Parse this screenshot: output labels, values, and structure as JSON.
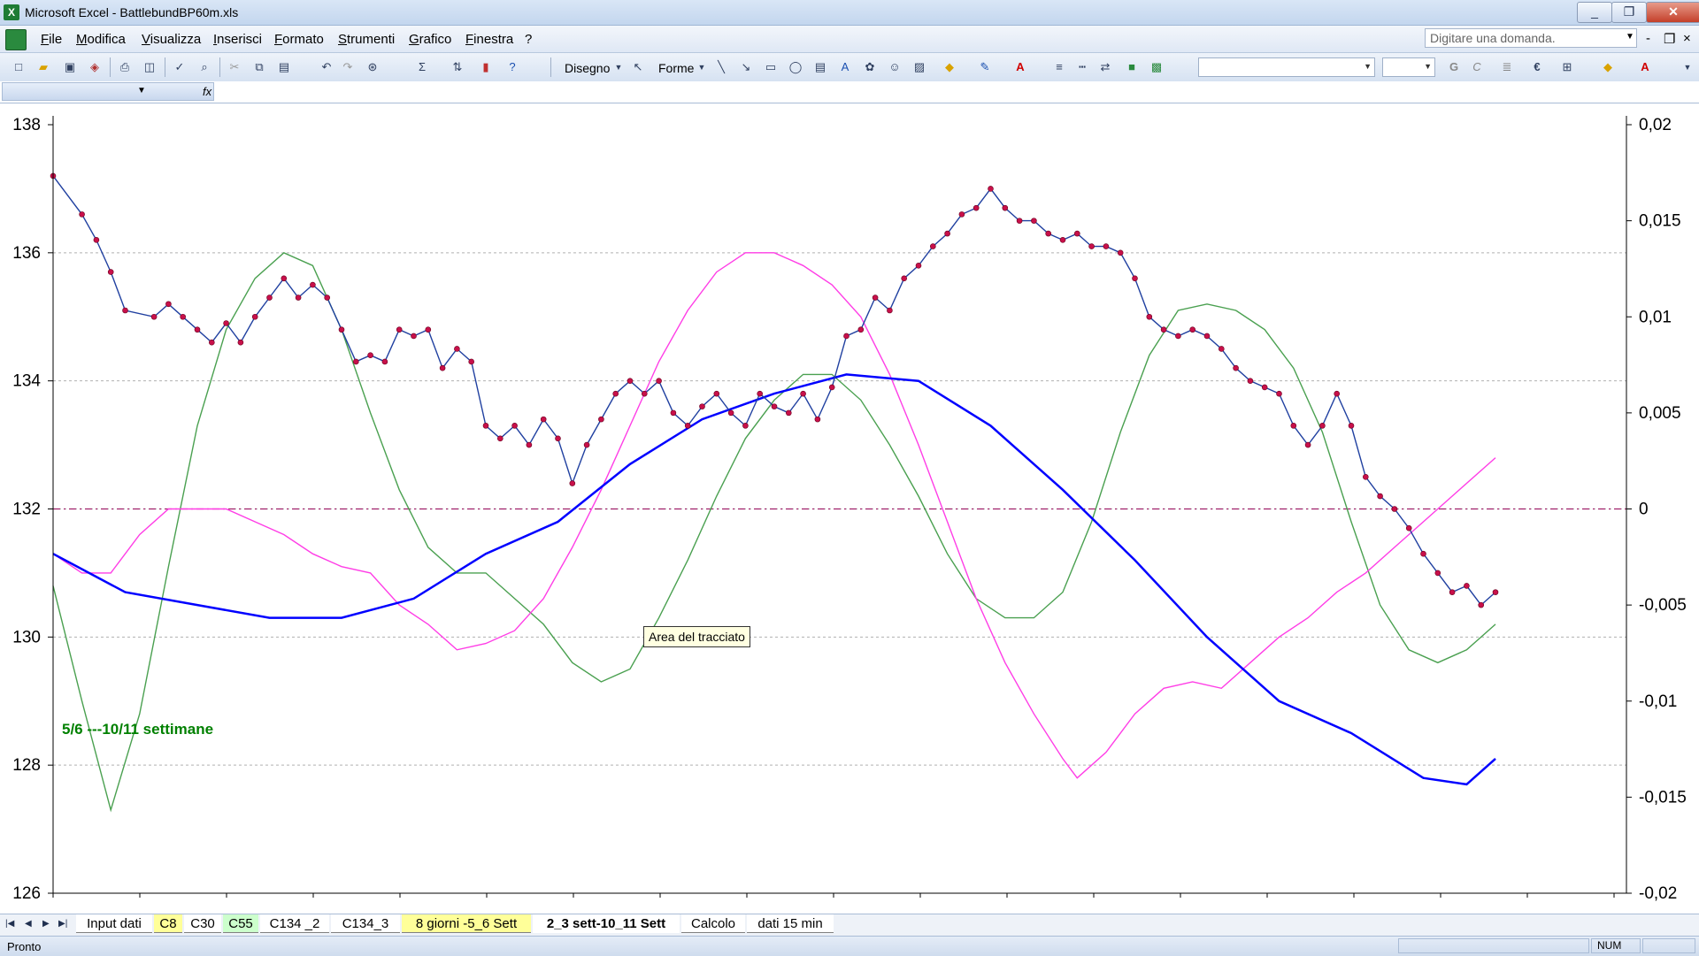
{
  "window": {
    "title": "Microsoft Excel - BattlebundBP60m.xls",
    "minimize": "_",
    "maximize": "❐",
    "close": "✕"
  },
  "menubar": {
    "items": [
      "File",
      "Modifica",
      "Visualizza",
      "Inserisci",
      "Formato",
      "Strumenti",
      "Grafico",
      "Finestra",
      "?"
    ],
    "help_placeholder": "Digitare una domanda.",
    "mdi_controls": [
      "-",
      "❐",
      "×"
    ]
  },
  "toolbar": {
    "draw_label": "Disegno",
    "shapes_label": "Forme"
  },
  "sheet_tabs": [
    {
      "label": "Input dati",
      "style": "normal"
    },
    {
      "label": "C8",
      "style": "yellow"
    },
    {
      "label": "C30",
      "style": "normal"
    },
    {
      "label": "C55",
      "style": "green"
    },
    {
      "label": "C134 _2",
      "style": "normal"
    },
    {
      "label": "C134_3",
      "style": "normal"
    },
    {
      "label": "8 giorni -5_6 Sett",
      "style": "yellow"
    },
    {
      "label": "2_3 sett-10_11 Sett",
      "style": "active"
    },
    {
      "label": "Calcolo",
      "style": "normal"
    },
    {
      "label": "dati 15 min",
      "style": "normal"
    }
  ],
  "status": {
    "text": "Pronto",
    "num": "NUM"
  },
  "tooltip": "Area del tracciato",
  "chart_data": {
    "type": "line",
    "annotation": "5/6 ---10/11 settimane",
    "y_left": {
      "min": 126,
      "max": 138,
      "ticks": [
        "138",
        "136",
        "134",
        "132",
        "130",
        "128",
        "126"
      ]
    },
    "y_right": {
      "min": -0.02,
      "max": 0.02,
      "ticks": [
        "0,02",
        "0,015",
        "0,01",
        "0,005",
        "0",
        "-0,005",
        "-0,01",
        "-0,015",
        "-0,02"
      ]
    },
    "gridlines": true,
    "x_range": [
      0,
      100
    ],
    "series": [
      {
        "color": "#2040a0",
        "marker_color": "#c8104a",
        "axis": "left",
        "points": [
          [
            0,
            137.2
          ],
          [
            2,
            136.6
          ],
          [
            3,
            136.2
          ],
          [
            4,
            135.7
          ],
          [
            5,
            135.1
          ],
          [
            7,
            135.0
          ],
          [
            8,
            135.2
          ],
          [
            9,
            135.0
          ],
          [
            10,
            134.8
          ],
          [
            11,
            134.6
          ],
          [
            12,
            134.9
          ],
          [
            13,
            134.6
          ],
          [
            14,
            135.0
          ],
          [
            15,
            135.3
          ],
          [
            16,
            135.6
          ],
          [
            17,
            135.3
          ],
          [
            18,
            135.5
          ],
          [
            19,
            135.3
          ],
          [
            20,
            134.8
          ],
          [
            21,
            134.3
          ],
          [
            22,
            134.4
          ],
          [
            23,
            134.3
          ],
          [
            24,
            134.8
          ],
          [
            25,
            134.7
          ],
          [
            26,
            134.8
          ],
          [
            27,
            134.2
          ],
          [
            28,
            134.5
          ],
          [
            29,
            134.3
          ],
          [
            30,
            133.3
          ],
          [
            31,
            133.1
          ],
          [
            32,
            133.3
          ],
          [
            33,
            133.0
          ],
          [
            34,
            133.4
          ],
          [
            35,
            133.1
          ],
          [
            36,
            132.4
          ],
          [
            37,
            133.0
          ],
          [
            38,
            133.4
          ],
          [
            39,
            133.8
          ],
          [
            40,
            134.0
          ],
          [
            41,
            133.8
          ],
          [
            42,
            134.0
          ],
          [
            43,
            133.5
          ],
          [
            44,
            133.3
          ],
          [
            45,
            133.6
          ],
          [
            46,
            133.8
          ],
          [
            47,
            133.5
          ],
          [
            48,
            133.3
          ],
          [
            49,
            133.8
          ],
          [
            50,
            133.6
          ],
          [
            51,
            133.5
          ],
          [
            52,
            133.8
          ],
          [
            53,
            133.4
          ],
          [
            54,
            133.9
          ],
          [
            55,
            134.7
          ],
          [
            56,
            134.8
          ],
          [
            57,
            135.3
          ],
          [
            58,
            135.1
          ],
          [
            59,
            135.6
          ],
          [
            60,
            135.8
          ],
          [
            61,
            136.1
          ],
          [
            62,
            136.3
          ],
          [
            63,
            136.6
          ],
          [
            64,
            136.7
          ],
          [
            65,
            137.0
          ],
          [
            66,
            136.7
          ],
          [
            67,
            136.5
          ],
          [
            68,
            136.5
          ],
          [
            69,
            136.3
          ],
          [
            70,
            136.2
          ],
          [
            71,
            136.3
          ],
          [
            72,
            136.1
          ],
          [
            73,
            136.1
          ],
          [
            74,
            136.0
          ],
          [
            75,
            135.6
          ],
          [
            76,
            135.0
          ],
          [
            77,
            134.8
          ],
          [
            78,
            134.7
          ],
          [
            79,
            134.8
          ],
          [
            80,
            134.7
          ],
          [
            81,
            134.5
          ],
          [
            82,
            134.2
          ],
          [
            83,
            134.0
          ],
          [
            84,
            133.9
          ],
          [
            85,
            133.8
          ],
          [
            86,
            133.3
          ],
          [
            87,
            133.0
          ],
          [
            88,
            133.3
          ],
          [
            89,
            133.8
          ],
          [
            90,
            133.3
          ],
          [
            91,
            132.5
          ],
          [
            92,
            132.2
          ],
          [
            93,
            132.0
          ],
          [
            94,
            131.7
          ],
          [
            95,
            131.3
          ],
          [
            96,
            131.0
          ],
          [
            97,
            130.7
          ],
          [
            98,
            130.8
          ],
          [
            99,
            130.5
          ],
          [
            100,
            130.7
          ]
        ]
      },
      {
        "color": "#0000ff",
        "width": 2.5,
        "axis": "left",
        "points": [
          [
            0,
            131.3
          ],
          [
            5,
            130.7
          ],
          [
            10,
            130.5
          ],
          [
            15,
            130.3
          ],
          [
            20,
            130.3
          ],
          [
            25,
            130.6
          ],
          [
            30,
            131.3
          ],
          [
            35,
            131.8
          ],
          [
            40,
            132.7
          ],
          [
            45,
            133.4
          ],
          [
            50,
            133.8
          ],
          [
            55,
            134.1
          ],
          [
            60,
            134.0
          ],
          [
            65,
            133.3
          ],
          [
            70,
            132.3
          ],
          [
            75,
            131.2
          ],
          [
            80,
            130.0
          ],
          [
            85,
            129.0
          ],
          [
            90,
            128.5
          ],
          [
            95,
            127.8
          ],
          [
            98,
            127.7
          ],
          [
            100,
            128.1
          ]
        ]
      },
      {
        "color": "#ff3de6",
        "axis": "left",
        "points": [
          [
            0,
            131.3
          ],
          [
            2,
            131.0
          ],
          [
            4,
            131.0
          ],
          [
            6,
            131.6
          ],
          [
            8,
            132.0
          ],
          [
            10,
            132.0
          ],
          [
            12,
            132.0
          ],
          [
            14,
            131.8
          ],
          [
            16,
            131.6
          ],
          [
            18,
            131.3
          ],
          [
            20,
            131.1
          ],
          [
            22,
            131.0
          ],
          [
            24,
            130.5
          ],
          [
            26,
            130.2
          ],
          [
            28,
            129.8
          ],
          [
            30,
            129.9
          ],
          [
            32,
            130.1
          ],
          [
            34,
            130.6
          ],
          [
            36,
            131.4
          ],
          [
            38,
            132.3
          ],
          [
            40,
            133.3
          ],
          [
            42,
            134.3
          ],
          [
            44,
            135.1
          ],
          [
            46,
            135.7
          ],
          [
            48,
            136.0
          ],
          [
            50,
            136.0
          ],
          [
            52,
            135.8
          ],
          [
            54,
            135.5
          ],
          [
            56,
            135.0
          ],
          [
            58,
            134.1
          ],
          [
            60,
            133.0
          ],
          [
            62,
            131.8
          ],
          [
            64,
            130.6
          ],
          [
            66,
            129.6
          ],
          [
            68,
            128.8
          ],
          [
            70,
            128.1
          ],
          [
            71,
            127.8
          ],
          [
            73,
            128.2
          ],
          [
            75,
            128.8
          ],
          [
            77,
            129.2
          ],
          [
            79,
            129.3
          ],
          [
            81,
            129.2
          ],
          [
            83,
            129.6
          ],
          [
            85,
            130.0
          ],
          [
            87,
            130.3
          ],
          [
            89,
            130.7
          ],
          [
            91,
            131.0
          ],
          [
            93,
            131.4
          ],
          [
            95,
            131.8
          ],
          [
            97,
            132.2
          ],
          [
            100,
            132.8
          ]
        ]
      },
      {
        "color": "#4aa050",
        "axis": "left",
        "points": [
          [
            0,
            130.8
          ],
          [
            2,
            129.0
          ],
          [
            4,
            127.3
          ],
          [
            6,
            128.8
          ],
          [
            8,
            131.1
          ],
          [
            10,
            133.3
          ],
          [
            12,
            134.8
          ],
          [
            14,
            135.6
          ],
          [
            16,
            136.0
          ],
          [
            18,
            135.8
          ],
          [
            20,
            134.8
          ],
          [
            22,
            133.5
          ],
          [
            24,
            132.3
          ],
          [
            26,
            131.4
          ],
          [
            28,
            131.0
          ],
          [
            30,
            131.0
          ],
          [
            32,
            130.6
          ],
          [
            34,
            130.2
          ],
          [
            36,
            129.6
          ],
          [
            38,
            129.3
          ],
          [
            40,
            129.5
          ],
          [
            42,
            130.3
          ],
          [
            44,
            131.2
          ],
          [
            46,
            132.2
          ],
          [
            48,
            133.1
          ],
          [
            50,
            133.7
          ],
          [
            52,
            134.1
          ],
          [
            54,
            134.1
          ],
          [
            56,
            133.7
          ],
          [
            58,
            133.0
          ],
          [
            60,
            132.2
          ],
          [
            62,
            131.3
          ],
          [
            64,
            130.6
          ],
          [
            66,
            130.3
          ],
          [
            68,
            130.3
          ],
          [
            70,
            130.7
          ],
          [
            72,
            131.8
          ],
          [
            74,
            133.2
          ],
          [
            76,
            134.4
          ],
          [
            78,
            135.1
          ],
          [
            80,
            135.2
          ],
          [
            82,
            135.1
          ],
          [
            84,
            134.8
          ],
          [
            86,
            134.2
          ],
          [
            88,
            133.2
          ],
          [
            90,
            131.8
          ],
          [
            92,
            130.5
          ],
          [
            94,
            129.8
          ],
          [
            96,
            129.6
          ],
          [
            98,
            129.8
          ],
          [
            100,
            130.2
          ]
        ]
      }
    ]
  }
}
